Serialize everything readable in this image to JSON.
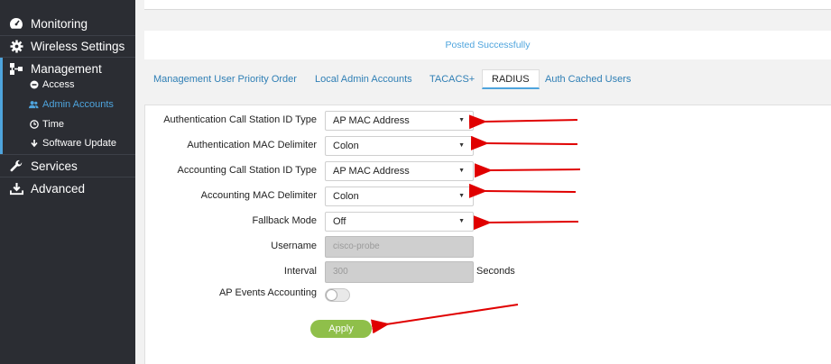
{
  "sidebar": {
    "items": [
      {
        "label": "Monitoring",
        "icon": "dashboard-icon"
      },
      {
        "label": "Wireless Settings",
        "icon": "gear-icon"
      },
      {
        "label": "Management",
        "icon": "sitemap-icon"
      },
      {
        "label": "Services",
        "icon": "wrench-icon"
      },
      {
        "label": "Advanced",
        "icon": "download-icon"
      }
    ],
    "sub_items": [
      {
        "label": "Access",
        "icon": "minus-circle-icon"
      },
      {
        "label": "Admin Accounts",
        "icon": "users-icon",
        "active": true
      },
      {
        "label": "Time",
        "icon": "clock-icon"
      },
      {
        "label": "Software Update",
        "icon": "arrow-down-icon"
      }
    ]
  },
  "status": {
    "message": "Posted Successfully"
  },
  "tabs": [
    {
      "label": "Management User Priority Order"
    },
    {
      "label": "Local Admin Accounts"
    },
    {
      "label": "TACACS+"
    },
    {
      "label": "RADIUS",
      "active": true
    },
    {
      "label": "Auth Cached Users"
    }
  ],
  "form": {
    "auth_call_station_id_type": {
      "label": "Authentication Call Station ID Type",
      "value": "AP MAC Address"
    },
    "auth_mac_delimiter": {
      "label": "Authentication MAC Delimiter",
      "value": "Colon"
    },
    "acct_call_station_id_type": {
      "label": "Accounting Call Station ID Type",
      "value": "AP MAC Address"
    },
    "acct_mac_delimiter": {
      "label": "Accounting MAC Delimiter",
      "value": "Colon"
    },
    "fallback_mode": {
      "label": "Fallback Mode",
      "value": "Off"
    },
    "username": {
      "label": "Username",
      "placeholder": "cisco-probe"
    },
    "interval": {
      "label": "Interval",
      "placeholder": "300",
      "unit": "Seconds"
    },
    "ap_events_accounting": {
      "label": "AP Events Accounting",
      "enabled": false
    },
    "apply_label": "Apply"
  },
  "colors": {
    "accent": "#4ea4dd",
    "apply": "#8fbf4a",
    "arrow": "#e00000",
    "sidebar": "#2b2d33"
  }
}
